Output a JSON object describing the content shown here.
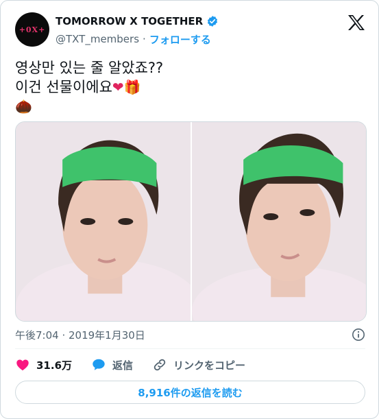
{
  "author": {
    "avatar_text": "+0X+",
    "display_name": "TOMORROW X TOGETHER",
    "handle": "@TXT_members",
    "separator": "·",
    "follow_label": "フォローする"
  },
  "tweet": {
    "line1": "영상만 있는 줄 알았죠??",
    "line2": "이건 선물이에요",
    "emoji_heart": "❤",
    "emoji_gift": "🎁",
    "emoji_chestnut": "🌰"
  },
  "media": {
    "count": 2
  },
  "meta": {
    "timestamp": "午後7:04 · 2019年1月30日"
  },
  "actions": {
    "likes": "31.6万",
    "reply_label": "返信",
    "copy_link_label": "リンクをコピー"
  },
  "footer": {
    "read_replies_label": "8,916件の返信を読む"
  },
  "colors": {
    "accent": "#1d9bf0",
    "like": "#f91880",
    "text": "#0f1419",
    "secondary": "#536471",
    "border": "#cfd9de"
  }
}
